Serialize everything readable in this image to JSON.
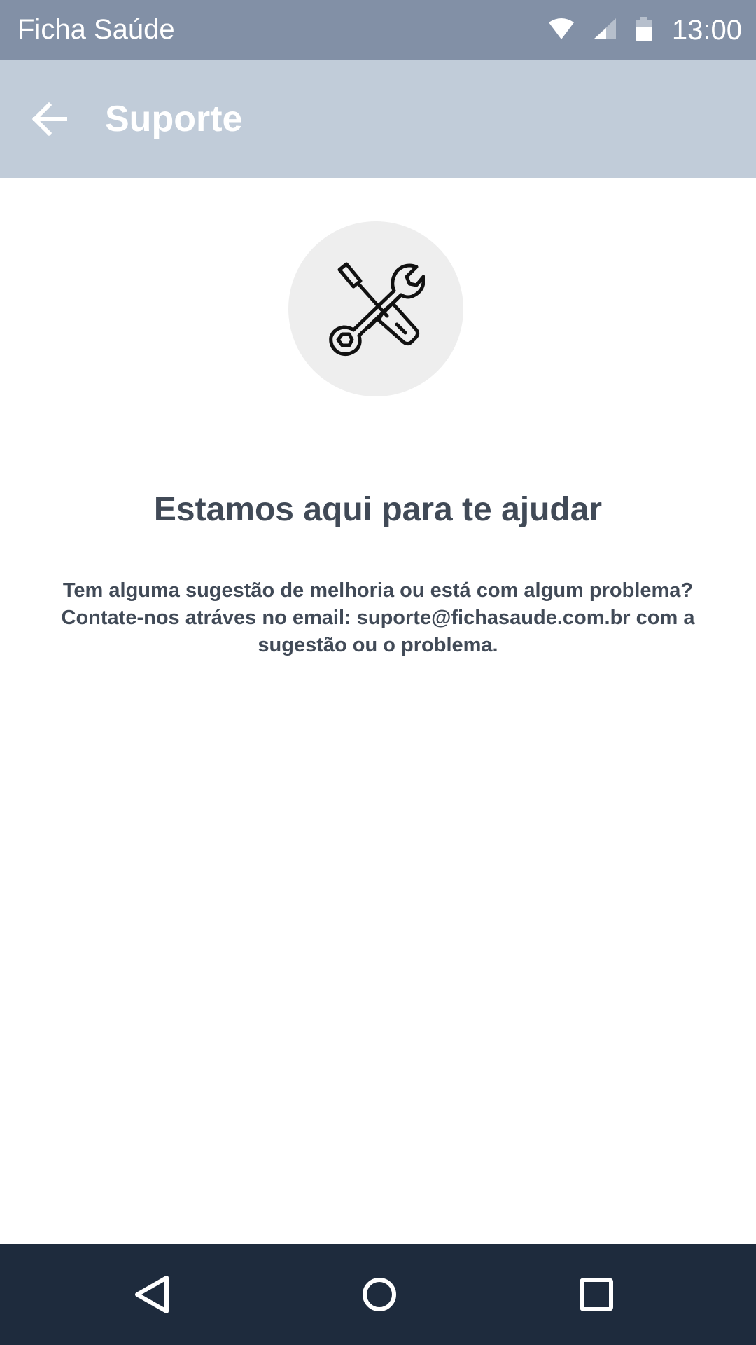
{
  "status_bar": {
    "app_name": "Ficha Saúde",
    "time": "13:00",
    "icons": [
      "wifi-icon",
      "cellular-signal-icon",
      "battery-icon"
    ]
  },
  "app_bar": {
    "title": "Suporte",
    "back_icon": "arrow-left-icon"
  },
  "content": {
    "illustration_icon": "tools-icon",
    "headline": "Estamos aqui para te ajudar",
    "body_line_1": "Tem alguma sugestão de melhoria ou está com algum problema?",
    "body_line_2": "Contate-nos atráves no email: suporte@fichasaude.com.br com a",
    "body_line_3": "sugestão ou o problema."
  },
  "nav_bar": {
    "icons": [
      "nav-back-icon",
      "nav-home-icon",
      "nav-recents-icon"
    ]
  },
  "colors": {
    "status_bar": "#8290a6",
    "app_bar": "#c1ccd9",
    "text_dark": "#414a57",
    "icon_circle": "#eeeeee",
    "nav_bar": "#1e2b3d"
  }
}
